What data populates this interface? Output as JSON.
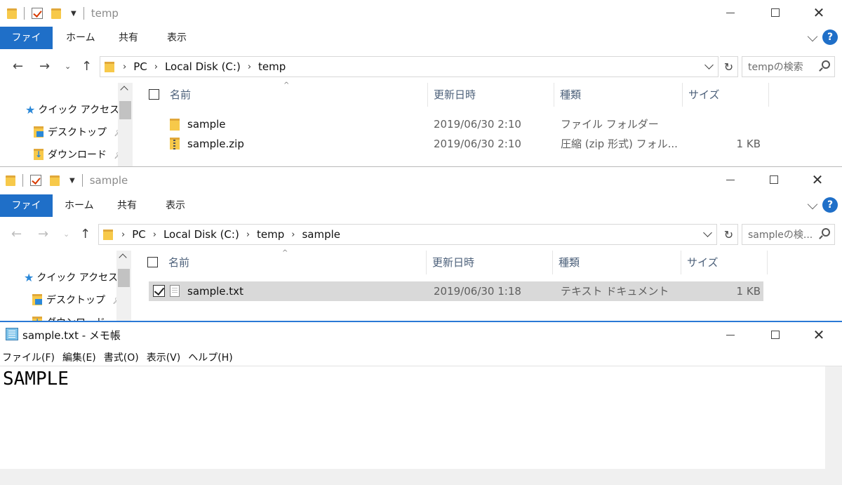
{
  "explorer1": {
    "title": "temp",
    "tabs": [
      "ファイル",
      "ホーム",
      "共有",
      "表示"
    ],
    "breadcrumb": [
      "PC",
      "Local Disk (C:)",
      "temp"
    ],
    "search_placeholder": "tempの検索",
    "nav": {
      "quick_access": "クイック アクセス",
      "desktop": "デスクトップ",
      "downloads": "ダウンロード"
    },
    "columns": [
      "名前",
      "更新日時",
      "種類",
      "サイズ"
    ],
    "files": [
      {
        "name": "sample",
        "date": "2019/06/30 2:10",
        "type": "ファイル フォルダー",
        "size": "",
        "icon": "folder-icon"
      },
      {
        "name": "sample.zip",
        "date": "2019/06/30 2:10",
        "type": "圧縮 (zip 形式) フォル...",
        "size": "1 KB",
        "icon": "zip-icon"
      }
    ]
  },
  "explorer2": {
    "title": "sample",
    "tabs": [
      "ファイル",
      "ホーム",
      "共有",
      "表示"
    ],
    "breadcrumb": [
      "PC",
      "Local Disk (C:)",
      "temp",
      "sample"
    ],
    "search_placeholder": "sampleの検...",
    "nav": {
      "quick_access": "クイック アクセス",
      "desktop": "デスクトップ",
      "downloads": "ダウンロード"
    },
    "columns": [
      "名前",
      "更新日時",
      "種類",
      "サイズ"
    ],
    "files": [
      {
        "name": "sample.txt",
        "date": "2019/06/30 1:18",
        "type": "テキスト ドキュメント",
        "size": "1 KB",
        "icon": "text-file-icon",
        "selected": true
      }
    ]
  },
  "notepad": {
    "title": "sample.txt - メモ帳",
    "menu": [
      "ファイル(F)",
      "編集(E)",
      "書式(O)",
      "表示(V)",
      "ヘルプ(H)"
    ],
    "content": "SAMPLE"
  },
  "colors": {
    "accent": "#1f6fc8",
    "selection": "#d9d9d9"
  }
}
